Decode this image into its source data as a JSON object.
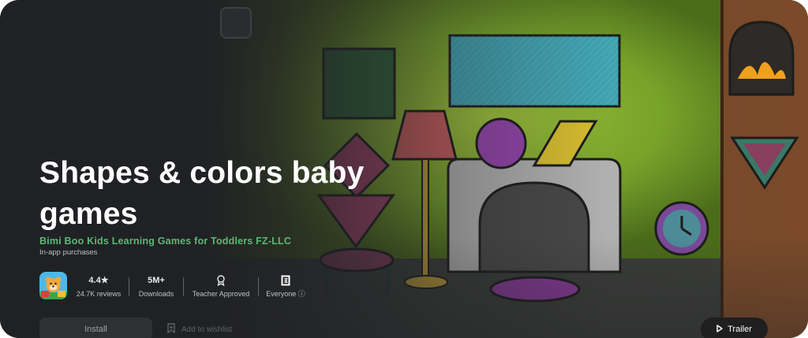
{
  "app": {
    "title": "Shapes & colors baby games",
    "developer": "Bimi Boo Kids Learning Games for Toddlers FZ-LLC",
    "in_app": "In-app purchases"
  },
  "stats": {
    "rating": {
      "value": "4.4★",
      "label": "24.7K reviews"
    },
    "downloads": {
      "value": "5M+",
      "label": "Downloads"
    },
    "teacher": {
      "label": "Teacher Approved"
    },
    "content_rating": {
      "label": "Everyone",
      "info_icon": "ⓘ"
    }
  },
  "actions": {
    "install": "Install",
    "wishlist": "Add to wishlist",
    "trailer": "Trailer"
  },
  "colors": {
    "developer_green": "#5bb974",
    "wall_green": "#7fae2a",
    "background": "#202124"
  },
  "icons": [
    "play-icon",
    "bookmark-icon",
    "ribbon-icon",
    "esrb-icon",
    "info-icon"
  ]
}
